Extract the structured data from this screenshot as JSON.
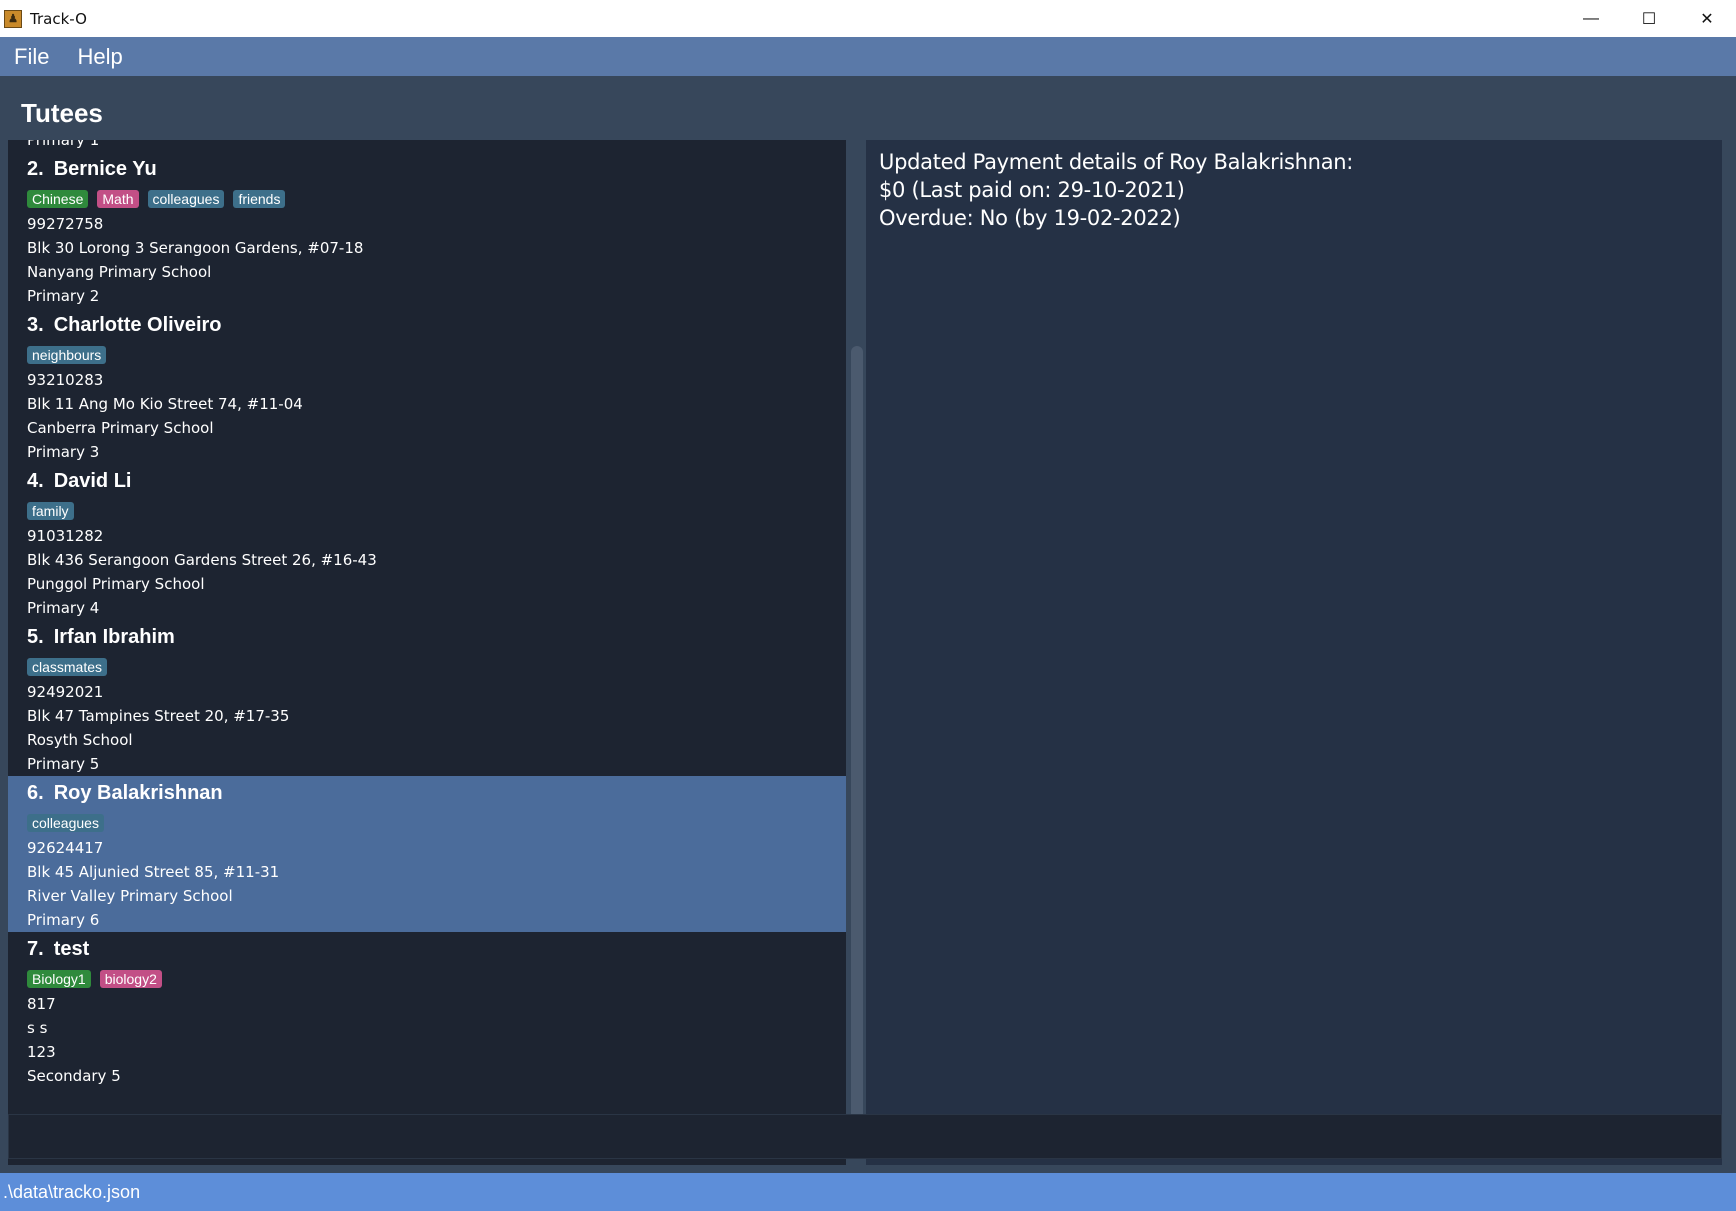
{
  "window": {
    "title": "Track-O",
    "icon": "app-icon",
    "minimize": "—",
    "maximize": "☐",
    "close": "✕"
  },
  "menu": [
    {
      "label": "File"
    },
    {
      "label": "Help"
    }
  ],
  "section_title": "Tutees",
  "tutees": [
    {
      "index": "1.",
      "name": "",
      "tags": [],
      "phone": "",
      "address": "",
      "school": "",
      "level": "Primary 1",
      "partial": true
    },
    {
      "index": "2.",
      "name": "Bernice Yu",
      "tags": [
        {
          "label": "Chinese",
          "color": "#2f8a3c"
        },
        {
          "label": "Math",
          "color": "#c24f86"
        },
        {
          "label": "colleagues",
          "color": "#3d6f8a"
        },
        {
          "label": "friends",
          "color": "#3d6f8a"
        }
      ],
      "phone": "99272758",
      "address": "Blk 30 Lorong 3 Serangoon Gardens, #07-18",
      "school": "Nanyang Primary School",
      "level": "Primary 2"
    },
    {
      "index": "3.",
      "name": "Charlotte Oliveiro",
      "tags": [
        {
          "label": "neighbours",
          "color": "#3d6f8a"
        }
      ],
      "phone": "93210283",
      "address": "Blk 11 Ang Mo Kio Street 74, #11-04",
      "school": "Canberra Primary School",
      "level": "Primary 3"
    },
    {
      "index": "4.",
      "name": "David Li",
      "tags": [
        {
          "label": "family",
          "color": "#3d6f8a"
        }
      ],
      "phone": "91031282",
      "address": "Blk 436 Serangoon Gardens Street 26, #16-43",
      "school": "Punggol Primary School",
      "level": "Primary 4"
    },
    {
      "index": "5.",
      "name": "Irfan Ibrahim",
      "tags": [
        {
          "label": "classmates",
          "color": "#3d6f8a"
        }
      ],
      "phone": "92492021",
      "address": "Blk 47 Tampines Street 20, #17-35",
      "school": "Rosyth School",
      "level": "Primary 5"
    },
    {
      "index": "6.",
      "name": "Roy Balakrishnan",
      "selected": true,
      "tags": [
        {
          "label": "colleagues",
          "color": "#3d6f8a"
        }
      ],
      "phone": "92624417",
      "address": "Blk 45 Aljunied Street 85, #11-31",
      "school": "River Valley Primary School",
      "level": "Primary 6"
    },
    {
      "index": "7.",
      "name": "test",
      "tags": [
        {
          "label": "Biology1",
          "color": "#2f8a3c"
        },
        {
          "label": "biology2",
          "color": "#c24f86"
        }
      ],
      "phone": "817",
      "address": "s s",
      "school": "123",
      "level": "Secondary 5"
    }
  ],
  "result": {
    "lines": [
      "Updated Payment details of Roy Balakrishnan:",
      "$0 (Last paid on: 29-10-2021)",
      "Overdue: No (by 19-02-2022)"
    ]
  },
  "command": {
    "value": "",
    "placeholder": ""
  },
  "status": {
    "path": ".\\data\\tracko.json"
  }
}
